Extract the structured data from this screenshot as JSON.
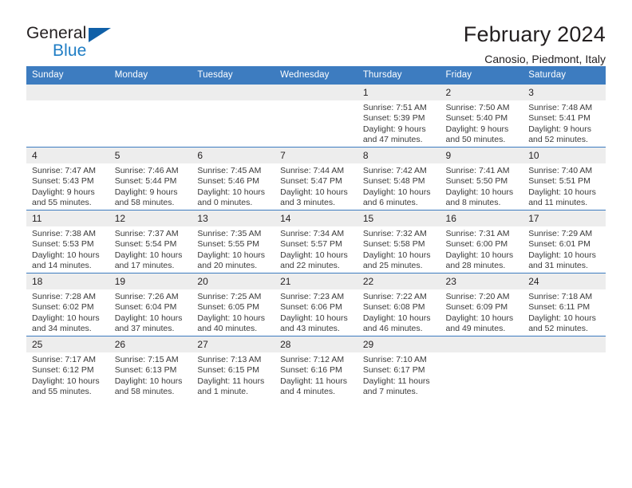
{
  "brand": {
    "line1": "General",
    "line2": "Blue",
    "triangle_color": "#1060a8",
    "blue_text_color": "#1f7dc4"
  },
  "header": {
    "title": "February 2024",
    "subtitle": "Canosio, Piedmont, Italy"
  },
  "theme": {
    "header_blue": "#3d7cc0",
    "daynum_band": "#ededed",
    "text": "#231f20"
  },
  "weekday_headers": [
    "Sunday",
    "Monday",
    "Tuesday",
    "Wednesday",
    "Thursday",
    "Friday",
    "Saturday"
  ],
  "weeks": [
    [
      {
        "day": "",
        "blank": true,
        "sunrise": "",
        "sunset": "",
        "daylight1": "",
        "daylight2": ""
      },
      {
        "day": "",
        "blank": true,
        "sunrise": "",
        "sunset": "",
        "daylight1": "",
        "daylight2": ""
      },
      {
        "day": "",
        "blank": true,
        "sunrise": "",
        "sunset": "",
        "daylight1": "",
        "daylight2": ""
      },
      {
        "day": "",
        "blank": true,
        "sunrise": "",
        "sunset": "",
        "daylight1": "",
        "daylight2": ""
      },
      {
        "day": "1",
        "blank": false,
        "sunrise": "Sunrise: 7:51 AM",
        "sunset": "Sunset: 5:39 PM",
        "daylight1": "Daylight: 9 hours",
        "daylight2": "and 47 minutes."
      },
      {
        "day": "2",
        "blank": false,
        "sunrise": "Sunrise: 7:50 AM",
        "sunset": "Sunset: 5:40 PM",
        "daylight1": "Daylight: 9 hours",
        "daylight2": "and 50 minutes."
      },
      {
        "day": "3",
        "blank": false,
        "sunrise": "Sunrise: 7:48 AM",
        "sunset": "Sunset: 5:41 PM",
        "daylight1": "Daylight: 9 hours",
        "daylight2": "and 52 minutes."
      }
    ],
    [
      {
        "day": "4",
        "blank": false,
        "sunrise": "Sunrise: 7:47 AM",
        "sunset": "Sunset: 5:43 PM",
        "daylight1": "Daylight: 9 hours",
        "daylight2": "and 55 minutes."
      },
      {
        "day": "5",
        "blank": false,
        "sunrise": "Sunrise: 7:46 AM",
        "sunset": "Sunset: 5:44 PM",
        "daylight1": "Daylight: 9 hours",
        "daylight2": "and 58 minutes."
      },
      {
        "day": "6",
        "blank": false,
        "sunrise": "Sunrise: 7:45 AM",
        "sunset": "Sunset: 5:46 PM",
        "daylight1": "Daylight: 10 hours",
        "daylight2": "and 0 minutes."
      },
      {
        "day": "7",
        "blank": false,
        "sunrise": "Sunrise: 7:44 AM",
        "sunset": "Sunset: 5:47 PM",
        "daylight1": "Daylight: 10 hours",
        "daylight2": "and 3 minutes."
      },
      {
        "day": "8",
        "blank": false,
        "sunrise": "Sunrise: 7:42 AM",
        "sunset": "Sunset: 5:48 PM",
        "daylight1": "Daylight: 10 hours",
        "daylight2": "and 6 minutes."
      },
      {
        "day": "9",
        "blank": false,
        "sunrise": "Sunrise: 7:41 AM",
        "sunset": "Sunset: 5:50 PM",
        "daylight1": "Daylight: 10 hours",
        "daylight2": "and 8 minutes."
      },
      {
        "day": "10",
        "blank": false,
        "sunrise": "Sunrise: 7:40 AM",
        "sunset": "Sunset: 5:51 PM",
        "daylight1": "Daylight: 10 hours",
        "daylight2": "and 11 minutes."
      }
    ],
    [
      {
        "day": "11",
        "blank": false,
        "sunrise": "Sunrise: 7:38 AM",
        "sunset": "Sunset: 5:53 PM",
        "daylight1": "Daylight: 10 hours",
        "daylight2": "and 14 minutes."
      },
      {
        "day": "12",
        "blank": false,
        "sunrise": "Sunrise: 7:37 AM",
        "sunset": "Sunset: 5:54 PM",
        "daylight1": "Daylight: 10 hours",
        "daylight2": "and 17 minutes."
      },
      {
        "day": "13",
        "blank": false,
        "sunrise": "Sunrise: 7:35 AM",
        "sunset": "Sunset: 5:55 PM",
        "daylight1": "Daylight: 10 hours",
        "daylight2": "and 20 minutes."
      },
      {
        "day": "14",
        "blank": false,
        "sunrise": "Sunrise: 7:34 AM",
        "sunset": "Sunset: 5:57 PM",
        "daylight1": "Daylight: 10 hours",
        "daylight2": "and 22 minutes."
      },
      {
        "day": "15",
        "blank": false,
        "sunrise": "Sunrise: 7:32 AM",
        "sunset": "Sunset: 5:58 PM",
        "daylight1": "Daylight: 10 hours",
        "daylight2": "and 25 minutes."
      },
      {
        "day": "16",
        "blank": false,
        "sunrise": "Sunrise: 7:31 AM",
        "sunset": "Sunset: 6:00 PM",
        "daylight1": "Daylight: 10 hours",
        "daylight2": "and 28 minutes."
      },
      {
        "day": "17",
        "blank": false,
        "sunrise": "Sunrise: 7:29 AM",
        "sunset": "Sunset: 6:01 PM",
        "daylight1": "Daylight: 10 hours",
        "daylight2": "and 31 minutes."
      }
    ],
    [
      {
        "day": "18",
        "blank": false,
        "sunrise": "Sunrise: 7:28 AM",
        "sunset": "Sunset: 6:02 PM",
        "daylight1": "Daylight: 10 hours",
        "daylight2": "and 34 minutes."
      },
      {
        "day": "19",
        "blank": false,
        "sunrise": "Sunrise: 7:26 AM",
        "sunset": "Sunset: 6:04 PM",
        "daylight1": "Daylight: 10 hours",
        "daylight2": "and 37 minutes."
      },
      {
        "day": "20",
        "blank": false,
        "sunrise": "Sunrise: 7:25 AM",
        "sunset": "Sunset: 6:05 PM",
        "daylight1": "Daylight: 10 hours",
        "daylight2": "and 40 minutes."
      },
      {
        "day": "21",
        "blank": false,
        "sunrise": "Sunrise: 7:23 AM",
        "sunset": "Sunset: 6:06 PM",
        "daylight1": "Daylight: 10 hours",
        "daylight2": "and 43 minutes."
      },
      {
        "day": "22",
        "blank": false,
        "sunrise": "Sunrise: 7:22 AM",
        "sunset": "Sunset: 6:08 PM",
        "daylight1": "Daylight: 10 hours",
        "daylight2": "and 46 minutes."
      },
      {
        "day": "23",
        "blank": false,
        "sunrise": "Sunrise: 7:20 AM",
        "sunset": "Sunset: 6:09 PM",
        "daylight1": "Daylight: 10 hours",
        "daylight2": "and 49 minutes."
      },
      {
        "day": "24",
        "blank": false,
        "sunrise": "Sunrise: 7:18 AM",
        "sunset": "Sunset: 6:11 PM",
        "daylight1": "Daylight: 10 hours",
        "daylight2": "and 52 minutes."
      }
    ],
    [
      {
        "day": "25",
        "blank": false,
        "sunrise": "Sunrise: 7:17 AM",
        "sunset": "Sunset: 6:12 PM",
        "daylight1": "Daylight: 10 hours",
        "daylight2": "and 55 minutes."
      },
      {
        "day": "26",
        "blank": false,
        "sunrise": "Sunrise: 7:15 AM",
        "sunset": "Sunset: 6:13 PM",
        "daylight1": "Daylight: 10 hours",
        "daylight2": "and 58 minutes."
      },
      {
        "day": "27",
        "blank": false,
        "sunrise": "Sunrise: 7:13 AM",
        "sunset": "Sunset: 6:15 PM",
        "daylight1": "Daylight: 11 hours",
        "daylight2": "and 1 minute."
      },
      {
        "day": "28",
        "blank": false,
        "sunrise": "Sunrise: 7:12 AM",
        "sunset": "Sunset: 6:16 PM",
        "daylight1": "Daylight: 11 hours",
        "daylight2": "and 4 minutes."
      },
      {
        "day": "29",
        "blank": false,
        "sunrise": "Sunrise: 7:10 AM",
        "sunset": "Sunset: 6:17 PM",
        "daylight1": "Daylight: 11 hours",
        "daylight2": "and 7 minutes."
      },
      {
        "day": "",
        "blank": true,
        "sunrise": "",
        "sunset": "",
        "daylight1": "",
        "daylight2": ""
      },
      {
        "day": "",
        "blank": true,
        "sunrise": "",
        "sunset": "",
        "daylight1": "",
        "daylight2": ""
      }
    ]
  ]
}
